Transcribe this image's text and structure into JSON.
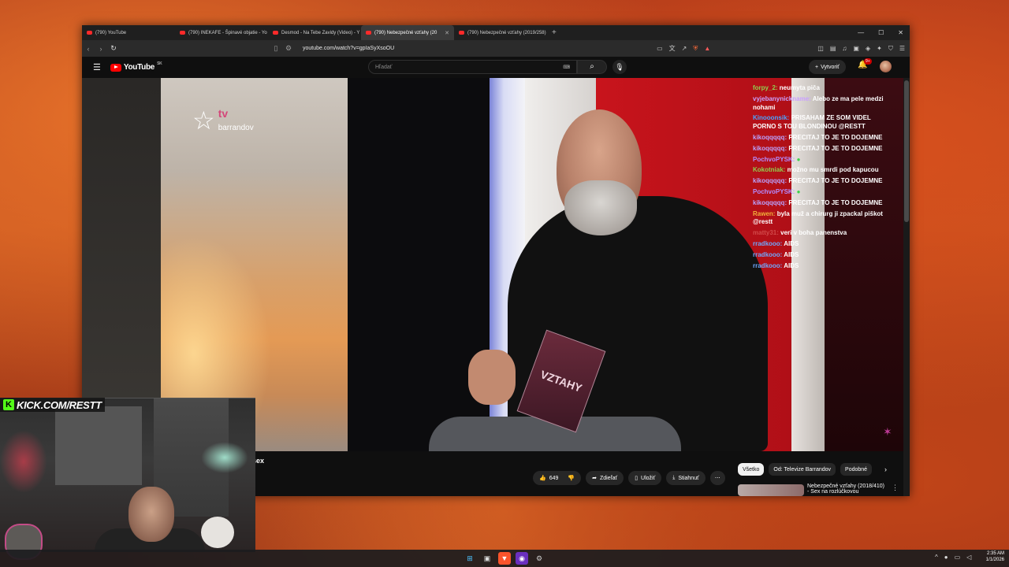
{
  "browser": {
    "tabs": [
      {
        "title": "(790) YouTube",
        "active": false
      },
      {
        "title": "(790) INEKAFE - Špinavé objatie - Yo",
        "active": false
      },
      {
        "title": "Desmod - Na Tebe Zavidy (Video) - Y",
        "active": false
      },
      {
        "title": "(790) Nebezpečné vzťahy (20",
        "active": true
      },
      {
        "title": "(790) Nebezpečné vzťahy (2019/258)",
        "active": false
      }
    ],
    "new_tab": "+",
    "window_controls": {
      "minimize": "—",
      "maximize": "☐",
      "close": "✕"
    },
    "url": "youtube.com/watch?v=gpIaSyXsoOU"
  },
  "youtube": {
    "logo_text": "YouTube",
    "region": "SK",
    "search_placeholder": "Hľadať",
    "create_label": "Vytvoriť",
    "notifications_badge": "9+"
  },
  "video": {
    "channel_logo_line1": "tv",
    "channel_logo_line2": "barrandov",
    "card_text": "VZTAHY",
    "title_fragment": "sex",
    "likes": "649",
    "actions": {
      "share": "Zdieľať",
      "save": "Uložiť",
      "download": "Stiahnuť",
      "more": "⋯"
    }
  },
  "chips": [
    "Všetko",
    "Od: Televize Barrandov",
    "Podobné"
  ],
  "recommendation": {
    "title_line1": "Nebezpečné vzťahy (2018/410)",
    "title_line2": "- Sex na rozlúčkovou"
  },
  "chat": [
    {
      "user": "forpy_2:",
      "color": "#8fd14f",
      "text": "neumyta piča"
    },
    {
      "user": "vyjebanynickname:",
      "color": "#c9a0ff",
      "text": "Alebo ze ma pele medzi nohami"
    },
    {
      "user": "Kinooonsik:",
      "color": "#4aa3ff",
      "text": "PRISAHAM ZE SOM VIDEL PORNO S TOU BLONDINOU @RESTT"
    },
    {
      "user": "kikoqqqqq:",
      "color": "#b9a3ff",
      "text": "PRECITAJ TO JE TO DOJEMNE"
    },
    {
      "user": "kikoqqqqq:",
      "color": "#b9a3ff",
      "text": "PRECITAJ TO JE TO DOJEMNE"
    },
    {
      "user": "PochvoPYSK:",
      "color": "#b38cff",
      "text": "●"
    },
    {
      "user": "Kokotniak:",
      "color": "#8fd14f",
      "text": "možno mu smrdi pod kapucou"
    },
    {
      "user": "kikoqqqqq:",
      "color": "#b9a3ff",
      "text": "PRECITAJ TO JE TO DOJEMNE"
    },
    {
      "user": "PochvoPYSK:",
      "color": "#b38cff",
      "text": "●"
    },
    {
      "user": "kikoqqqqq:",
      "color": "#b9a3ff",
      "text": "PRECITAJ TO JE TO DOJEMNE"
    },
    {
      "user": "Rawen:",
      "color": "#f2b23a",
      "text": "byla muž a chirurg ji zpackal piškot @restt"
    },
    {
      "user": "matty31:",
      "color": "#d24a4a",
      "text": "veri v boha panenstva"
    },
    {
      "user": "rradkooo:",
      "color": "#6fa8ff",
      "text": "AIDS"
    },
    {
      "user": "rradkooo:",
      "color": "#6fa8ff",
      "text": "AIDS"
    },
    {
      "user": "rradkooo:",
      "color": "#6fa8ff",
      "text": "AIDS"
    }
  ],
  "overlay": {
    "kick_letter": "K",
    "kick_text": "KICK.COM/RESTT"
  },
  "taskbar": {
    "time": "2:35 AM",
    "date": "1/1/2026"
  }
}
